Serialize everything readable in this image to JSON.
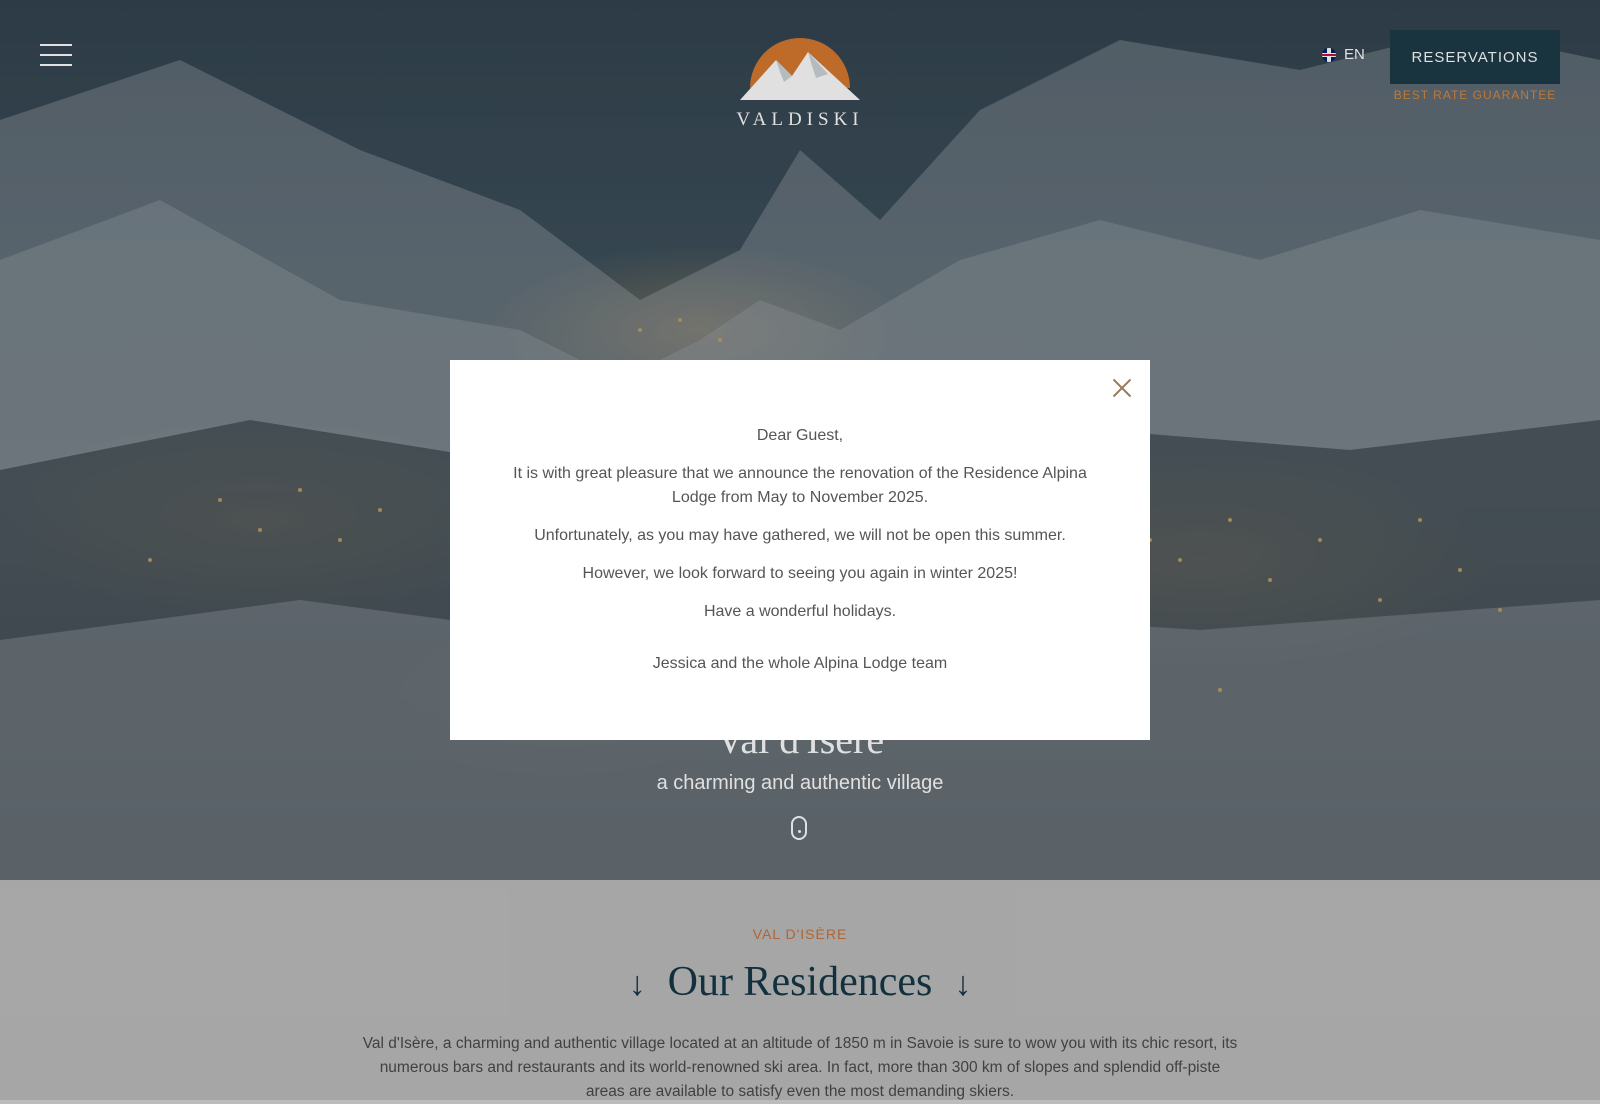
{
  "header": {
    "logo_text": "VALDISKI",
    "language": "EN",
    "reservations_label": "RESERVATIONS",
    "rate_tag": "BEST RATE GUARANTEE"
  },
  "hero": {
    "title": "Val d'Isère",
    "subtitle": "a charming and authentic village"
  },
  "section": {
    "eyebrow": "VAL D'ISÈRE",
    "heading": "Our Residences",
    "arrow": "↓",
    "intro": "Val d'Isère, a charming and authentic village located at an altitude of 1850 m in Savoie is sure to wow you with its chic resort, its numerous bars and restaurants and its world-renowned ski area. In fact, more than 300 km of slopes and splendid off-piste areas are available to satisfy even the most demanding skiers."
  },
  "modal": {
    "greeting": "Dear Guest,",
    "line1": "It is with great pleasure that we announce the renovation of the Residence Alpina Lodge from May to November 2025.",
    "line2": "Unfortunately, as you may have gathered, we will not be open this summer.",
    "line3": "However, we look forward to seeing you again in winter 2025!",
    "line4": "Have a wonderful holidays.",
    "signature": "Jessica and the whole Alpina Lodge team"
  },
  "colors": {
    "accent": "#d98a3f",
    "primary_dark": "#1d3b48",
    "logo_sun": "#d9792f"
  },
  "icons": {
    "menu": "hamburger-icon",
    "flag": "uk-flag-icon",
    "scroll": "mouse-scroll-icon",
    "close": "close-icon"
  }
}
